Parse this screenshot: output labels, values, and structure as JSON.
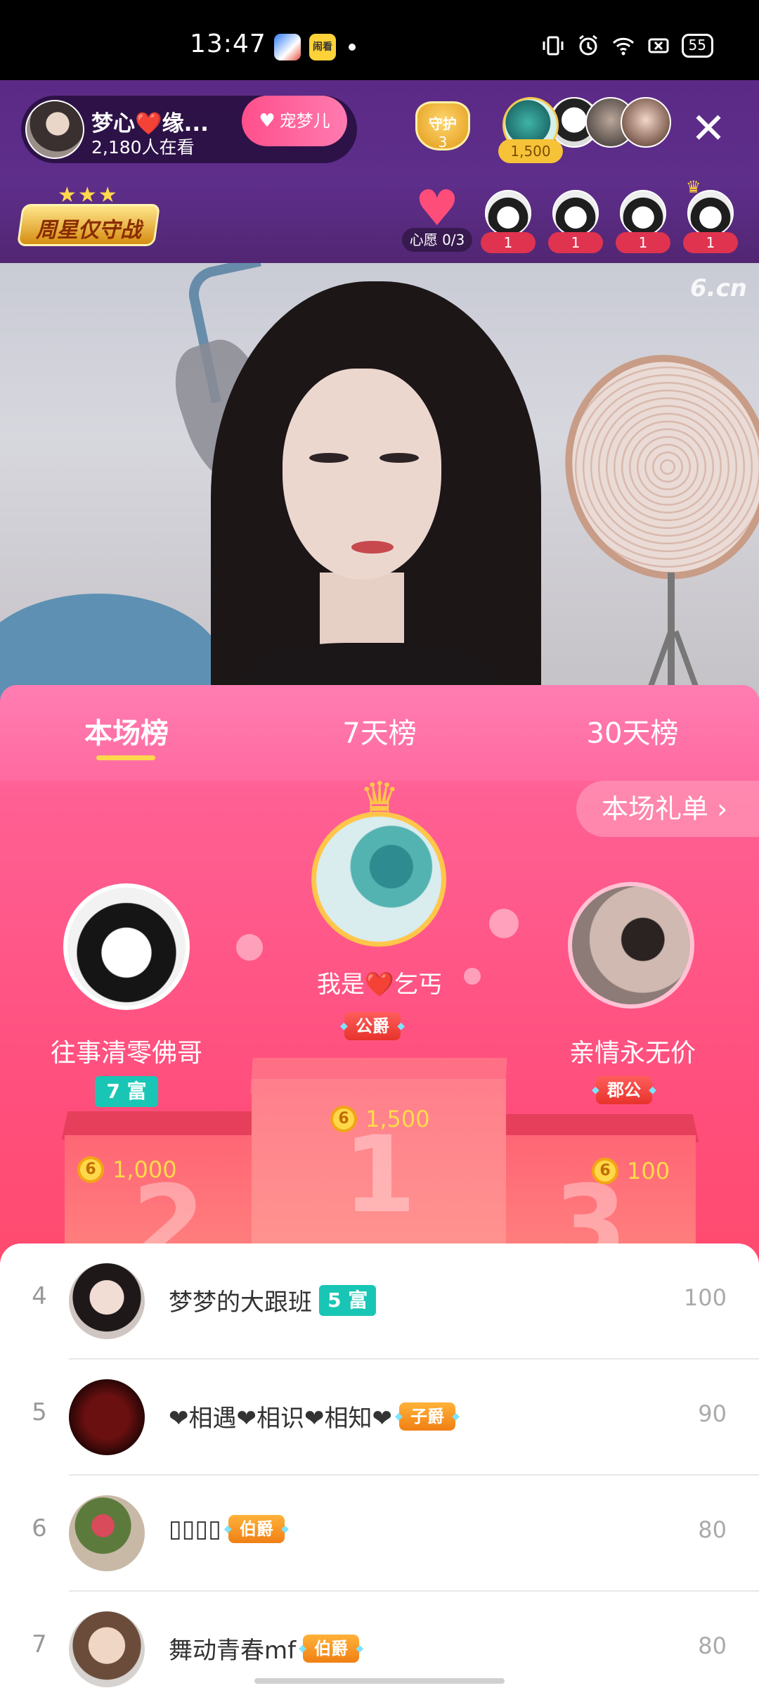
{
  "status_bar": {
    "time": "13:47",
    "app2_label": "闹看",
    "battery": "55",
    "icons": [
      "vibrate-icon",
      "alarm-icon",
      "wifi-icon",
      "sim-off-icon",
      "battery-icon"
    ]
  },
  "host": {
    "name": "梦心❤️缘...",
    "viewers": "2,180人在看",
    "follow_label": "宠梦儿"
  },
  "guard": {
    "label": "守护",
    "count": "3"
  },
  "top_fan": {
    "coins": "1,500"
  },
  "banner": {
    "label": "周星仅守战"
  },
  "wish": {
    "label": "心愿 0/3"
  },
  "mini_fans": [
    {
      "count": "1"
    },
    {
      "count": "1"
    },
    {
      "count": "1"
    },
    {
      "count": "1"
    }
  ],
  "video": {
    "watermark": "6.cn"
  },
  "tabs": [
    {
      "label": "本场榜",
      "active": true
    },
    {
      "label": "7天榜",
      "active": false
    },
    {
      "label": "30天榜",
      "active": false
    }
  ],
  "gift_list_label": "本场礼单 ›",
  "podium": {
    "first": {
      "name": "我是❤️乞丐",
      "badge": "公爵",
      "value": "1,500",
      "number": "1"
    },
    "second": {
      "name": "往事清零佛哥",
      "badge": "7 富",
      "value": "1,000",
      "number": "2"
    },
    "third": {
      "name": "亲情永无价",
      "badge": "郡公",
      "value": "100",
      "number": "3"
    }
  },
  "list": [
    {
      "rank": "4",
      "name": "梦梦的大跟班",
      "badge": "5 富",
      "badge_type": "wealth",
      "value": "100"
    },
    {
      "rank": "5",
      "name": "❤相遇❤相识❤相知❤",
      "badge": "子爵",
      "badge_type": "noble",
      "value": "90"
    },
    {
      "rank": "6",
      "name": "▯▯▯▯",
      "badge": "伯爵",
      "badge_type": "noble",
      "value": "80"
    },
    {
      "rank": "7",
      "name": "舞动青春mf",
      "badge": "伯爵",
      "badge_type": "noble",
      "value": "80"
    }
  ],
  "coin_glyph": "6",
  "colors": {
    "accent_pink": "#ff5f93",
    "gold": "#ffc64a",
    "wealth_teal": "#19c6b5"
  }
}
